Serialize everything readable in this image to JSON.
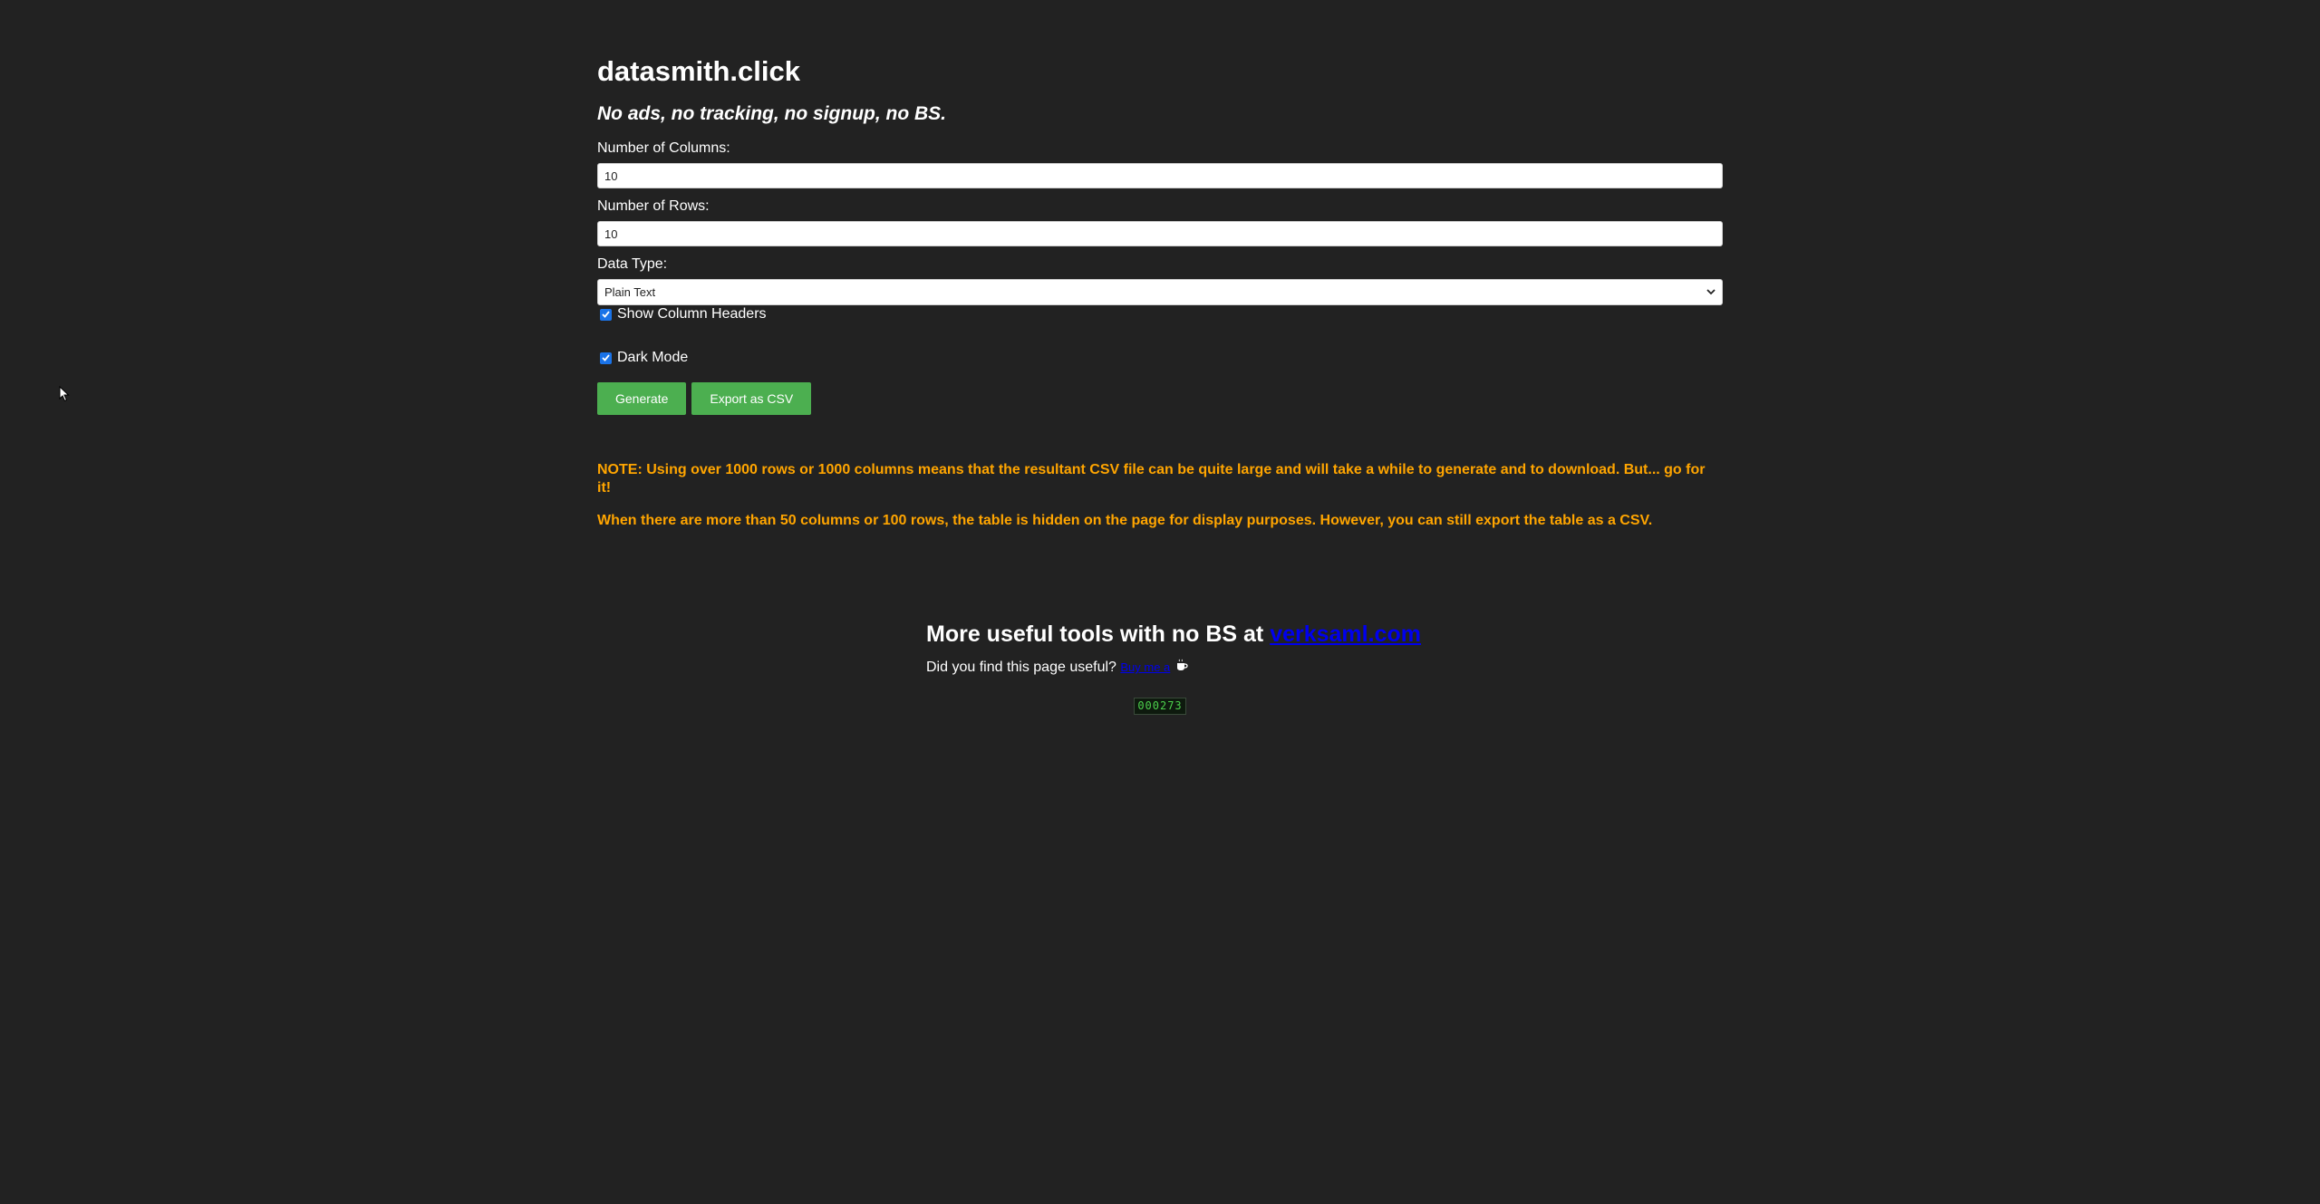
{
  "header": {
    "title": "datasmith.click",
    "tagline": "No ads, no tracking, no signup, no BS."
  },
  "form": {
    "columns_label": "Number of Columns:",
    "columns_value": "10",
    "rows_label": "Number of Rows:",
    "rows_value": "10",
    "data_type_label": "Data Type:",
    "data_type_value": "Plain Text",
    "show_headers_label": "Show Column Headers",
    "show_headers_checked": true,
    "dark_mode_label": "Dark Mode",
    "dark_mode_checked": true
  },
  "buttons": {
    "generate_label": "Generate",
    "export_label": "Export as CSV"
  },
  "notes": {
    "note1": "NOTE: Using over 1000 rows or 1000 columns means that the resultant CSV file can be quite large and will take a while to generate and to download. But... go for it!",
    "note2": "When there are more than 50 columns or 100 rows, the table is hidden on the page for display purposes. However, you can still export the table as a CSV."
  },
  "footer": {
    "heading_prefix": "More useful tools with no BS at ",
    "heading_link": "verksaml.com",
    "question": "Did you find this page useful?",
    "support_link": "Buy me a",
    "coffee_icon": "coffee-icon"
  },
  "counter": {
    "value": "000273"
  },
  "colors": {
    "background": "#222222",
    "accent_button": "#4caf50",
    "note_text": "#ffa500",
    "link": "#0000ee"
  }
}
